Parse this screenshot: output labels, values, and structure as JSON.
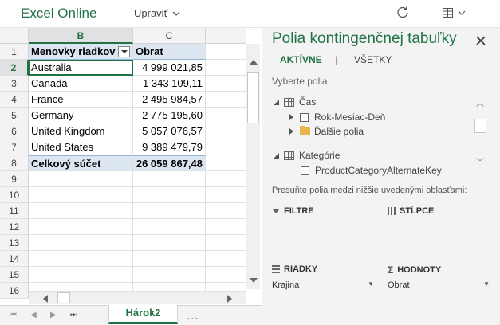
{
  "app": {
    "title": "Excel Online",
    "edit_menu": "Upraviť"
  },
  "sheet": {
    "columns": [
      "B",
      "C"
    ],
    "selected_column": "B",
    "rows": [
      "1",
      "2",
      "3",
      "4",
      "5",
      "6",
      "7",
      "8",
      "9",
      "10",
      "11",
      "12",
      "13",
      "14",
      "15",
      "16"
    ],
    "selected_row": "2",
    "pivot": {
      "header_row_label": "Menovky riadkov",
      "header_value": "Obrat",
      "items": [
        {
          "label": "Australia",
          "value": "4 999 021,85"
        },
        {
          "label": "Canada",
          "value": "1 343 109,11"
        },
        {
          "label": "France",
          "value": "2 495 984,57"
        },
        {
          "label": "Germany",
          "value": "2 775 195,60"
        },
        {
          "label": "United Kingdom",
          "value": "5 057 076,57"
        },
        {
          "label": "United States",
          "value": "9 389 479,79"
        }
      ],
      "total_label": "Celkový súčet",
      "total_value": "26 059 867,48"
    },
    "tabs": [
      "Hárok2"
    ],
    "more_tabs": "..."
  },
  "panel": {
    "title": "Polia kontingenčnej tabuľky",
    "tab_active": "AKTÍVNE",
    "tab_all": "VŠETKY",
    "choose_label": "Vyberte polia:",
    "tree": [
      {
        "label": "Čas",
        "type": "table"
      },
      {
        "label": "Rok-Mesiac-Deň",
        "type": "field"
      },
      {
        "label": "Ďalšie polia",
        "type": "folder"
      },
      {
        "label": "Kategórie",
        "type": "table"
      },
      {
        "label": "ProductCategoryAlternateKey",
        "type": "field"
      }
    ],
    "drag_hint": "Presuňte polia medzi nižšie uvedenými oblasťami:",
    "areas": {
      "filters": {
        "title": "FILTRE"
      },
      "columns": {
        "title": "STĹPCE"
      },
      "rows": {
        "title": "RIADKY",
        "field": "Krajina"
      },
      "values": {
        "title": "HODNOTY",
        "field": "Obrat"
      }
    }
  },
  "colors": {
    "accent": "#217346",
    "pivot_header_bg": "#dce6f1"
  }
}
